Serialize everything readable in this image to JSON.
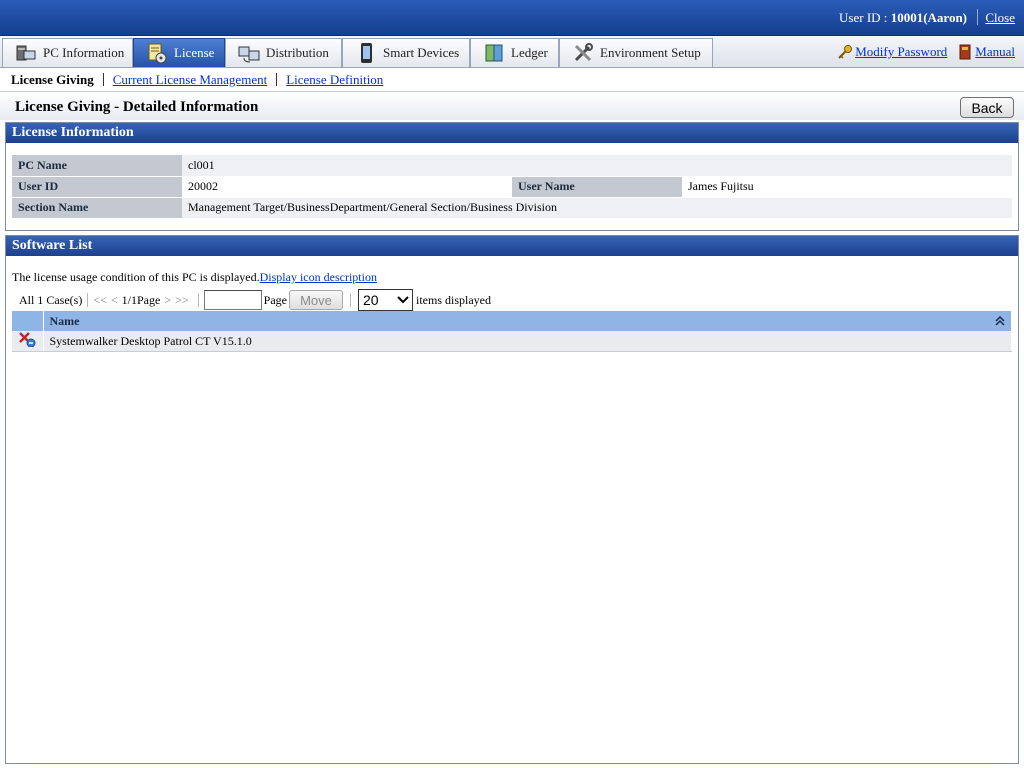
{
  "header": {
    "user_label": "User ID : ",
    "user_value": "10001(Aaron)",
    "close_label": "Close"
  },
  "tabs": [
    {
      "label": "PC Information",
      "icon": "pc-icon",
      "active": false
    },
    {
      "label": "License",
      "icon": "license-icon",
      "active": true
    },
    {
      "label": "Distribution",
      "icon": "distribution-icon",
      "active": false
    },
    {
      "label": "Smart Devices",
      "icon": "smartphone-icon",
      "active": false
    },
    {
      "label": "Ledger",
      "icon": "ledger-icon",
      "active": false
    },
    {
      "label": "Environment Setup",
      "icon": "tools-icon",
      "active": false
    }
  ],
  "toplinks": {
    "modify_password": "Modify Password",
    "manual": "Manual"
  },
  "subnav": {
    "current": "License Giving",
    "links": [
      "Current License Management",
      "License Definition"
    ]
  },
  "page": {
    "title": "License Giving - Detailed Information",
    "back_label": "Back"
  },
  "license_info": {
    "section_title": "License Information",
    "pc_name_label": "PC Name",
    "pc_name": "cl001",
    "user_id_label": "User ID",
    "user_id": "20002",
    "user_name_label": "User Name",
    "user_name": "James Fujitsu",
    "section_name_label": "Section Name",
    "section_name": "Management Target/BusinessDepartment/General Section/Business Division"
  },
  "software_list": {
    "section_title": "Software List",
    "description": "The license usage condition of this PC is displayed.",
    "icon_link": "Display icon description",
    "pager": {
      "total": "All 1 Case(s)",
      "first": "<<",
      "prev": "<",
      "page_info": "1/1Page",
      "next": ">",
      "last": ">>",
      "page_input_value": "",
      "page_label": "Page",
      "move_label": "Move",
      "per_page": "20",
      "per_page_suffix": "items displayed"
    },
    "columns": [
      "Name"
    ],
    "rows": [
      {
        "name": "Systemwalker Desktop Patrol CT V15.1.0",
        "icon": "license-status-icon"
      }
    ]
  },
  "colors": {
    "header_blue": "#1c418e",
    "active_tab": "#2453a8",
    "link": "#0033cc",
    "column_header": "#8fb4e6"
  }
}
